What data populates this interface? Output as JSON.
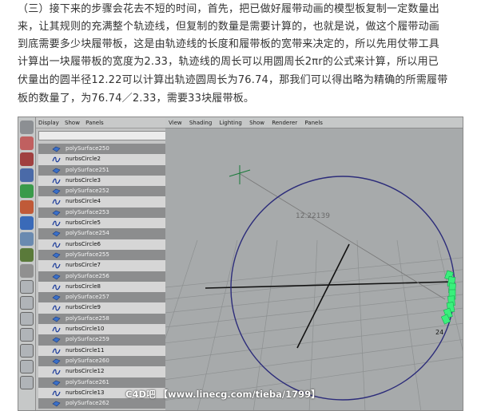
{
  "article": {
    "lines": [
      "（三）接下来的步骤会花去不短的时间，首先，把已做好履带动画的模型板复制一定数量出",
      "来，让其规则的充满整个轨迹线，但复制的数量是需要计算的，也就是说，做这个履带动画",
      "到底需要多少块履带板，这是由轨迹线的长度和履带板的宽带来决定的，所以先用仗带工具",
      "计算出一块履带板的宽度为2.33，轨迹线的周长可以用圆周长2πr的公式来计算，所以用已",
      "伏量出的圆半径12.22可以计算出轨迹圆周长为76.74，那我们可以得出略为精确的所需履带",
      "板的数量了，为76.74／2.33，需要33块履带板。"
    ]
  },
  "outliner": {
    "menu": [
      "Display",
      "Show",
      "Panels"
    ],
    "items": [
      {
        "label": "polySurface250",
        "kind": "poly"
      },
      {
        "label": "nurbsCircle2",
        "kind": "nurbs"
      },
      {
        "label": "polySurface251",
        "kind": "poly"
      },
      {
        "label": "nurbsCircle3",
        "kind": "nurbs"
      },
      {
        "label": "polySurface252",
        "kind": "poly"
      },
      {
        "label": "nurbsCircle4",
        "kind": "nurbs"
      },
      {
        "label": "polySurface253",
        "kind": "poly"
      },
      {
        "label": "nurbsCircle5",
        "kind": "nurbs"
      },
      {
        "label": "polySurface254",
        "kind": "poly"
      },
      {
        "label": "nurbsCircle6",
        "kind": "nurbs"
      },
      {
        "label": "polySurface255",
        "kind": "poly"
      },
      {
        "label": "nurbsCircle7",
        "kind": "nurbs"
      },
      {
        "label": "polySurface256",
        "kind": "poly"
      },
      {
        "label": "nurbsCircle8",
        "kind": "nurbs"
      },
      {
        "label": "polySurface257",
        "kind": "poly"
      },
      {
        "label": "nurbsCircle9",
        "kind": "nurbs"
      },
      {
        "label": "polySurface258",
        "kind": "poly"
      },
      {
        "label": "nurbsCircle10",
        "kind": "nurbs"
      },
      {
        "label": "polySurface259",
        "kind": "poly"
      },
      {
        "label": "nurbsCircle11",
        "kind": "nurbs"
      },
      {
        "label": "polySurface260",
        "kind": "poly"
      },
      {
        "label": "nurbsCircle12",
        "kind": "nurbs"
      },
      {
        "label": "polySurface261",
        "kind": "poly"
      },
      {
        "label": "nurbsCircle13",
        "kind": "nurbs"
      },
      {
        "label": "polySurface262",
        "kind": "poly"
      }
    ]
  },
  "viewport": {
    "menu": [
      "View",
      "Shading",
      "Lighting",
      "Show",
      "Renderer",
      "Panels"
    ],
    "measure_label": "12.22139",
    "vertex_label": "24",
    "colors": {
      "circle": "#2c2c7a",
      "track": "#38f07a",
      "grid": "#8d9091",
      "axis": "#111111",
      "manip": "#1a7a3a"
    }
  },
  "watermark": "C4D吧 【www.linecg.com/tieba/1799】",
  "icons": {
    "toolbox": [
      "select-tool-icon",
      "lasso-tool-icon",
      "paint-tool-icon",
      "move-tool-icon",
      "rotate-tool-icon",
      "scale-tool-icon",
      "universal-manip-icon",
      "soft-mod-icon",
      "show-manip-icon",
      "last-tool-icon",
      "layout-single-icon",
      "layout-four-icon",
      "layout-persp-outliner-icon",
      "layout-hypershade-icon",
      "layout-graph-icon",
      "layout-outliner-icon",
      "layout-render-icon"
    ],
    "row_poly": "poly-surface-icon",
    "row_nurbs": "nurbs-curve-icon"
  }
}
